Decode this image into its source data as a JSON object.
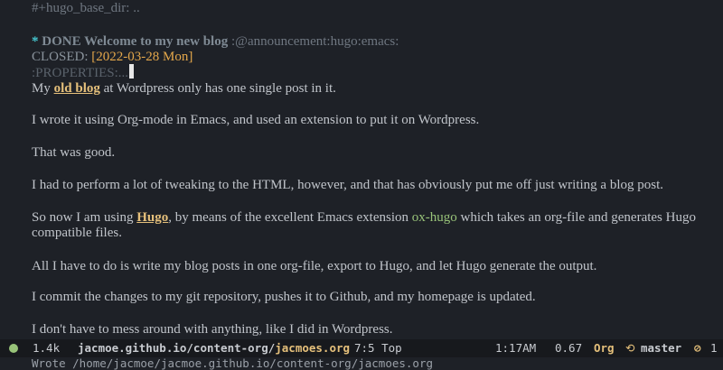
{
  "editor": {
    "base_dir_line": "#+hugo_base_dir: ..",
    "heading": {
      "star": "*",
      "text": "DONE Welcome to my new blog",
      "tags": ":@announcement:hugo:emacs:"
    },
    "closed": {
      "keyword": "CLOSED:",
      "timestamp": "[2022-03-28 Mon]"
    },
    "properties": ":PROPERTIES:..."
  },
  "body": {
    "p1": {
      "pre": "My ",
      "link": "old blog",
      "post": " at Wordpress only has one single post in it."
    },
    "p2": "I wrote it using Org-mode in Emacs, and used an extension to put it on Wordpress.",
    "p3": "That was good.",
    "p4": "I had to perform a lot of tweaking to the HTML, however, and that has obviously put me off just writing a blog post.",
    "p5": {
      "pre": "So now I am using ",
      "link1": "Hugo",
      "mid": ", by means of the excellent Emacs extension ",
      "link2": "ox-hugo",
      "post": " which takes an org-file and generates Hugo compatible files."
    },
    "p6": "All I have to do is write my blog posts in one org-file, export to Hugo, and let Hugo generate the output.",
    "p7": "I commit the changes to my git repository, pushes it to Github, and my homepage is updated.",
    "p8": "I don't have to mess around with anything, like I did in Wordpress."
  },
  "modeline": {
    "size": "1.4k",
    "file_dir": "jacmoe.github.io/content-org/",
    "file_base": "jacmoes.org",
    "position": "7:5 Top",
    "time": "1:17AM",
    "load": "0.67",
    "mode": "Org",
    "branch": "master",
    "errors": "1",
    "status_color": "#98c379"
  },
  "echo_area": "Wrote /home/jacmoe/jacmoe.github.io/content-org/jacmoes.org"
}
